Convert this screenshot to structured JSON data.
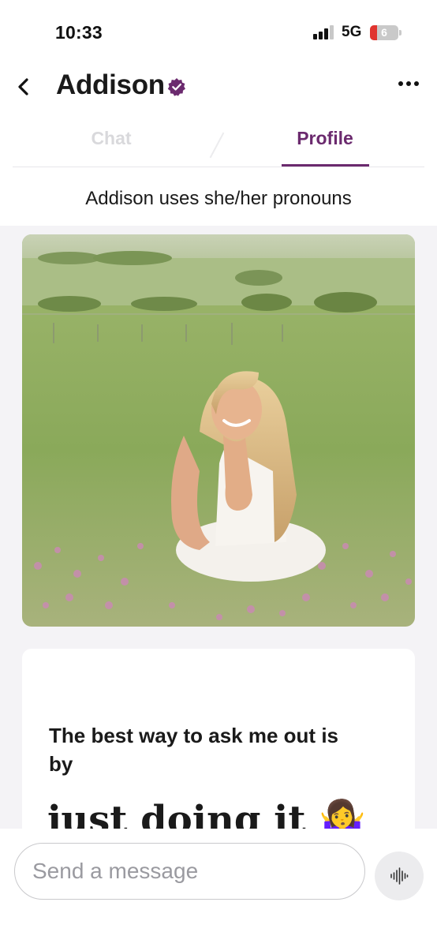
{
  "status_bar": {
    "time": "10:33",
    "network": "5G",
    "battery_level": "6"
  },
  "header": {
    "back_icon": "chevron-left-icon",
    "name": "Addison",
    "verified_icon": "verified-badge-icon",
    "more_icon": "more-horizontal-icon",
    "tabs": [
      {
        "label": "Chat",
        "active": false
      },
      {
        "label": "Profile",
        "active": true
      }
    ]
  },
  "profile": {
    "pronouns": "Addison uses she/her pronouns",
    "photo_icon": "profile-photo",
    "prompt": {
      "question": "The best way to ask me out is by",
      "answer": "just doing it 🤷‍♀️"
    }
  },
  "composer": {
    "placeholder": "Send a message",
    "voice_icon": "voice-waveform-icon"
  },
  "colors": {
    "accent": "#6b2a6e",
    "inactive_tab": "#d9d9dc",
    "background": "#f4f3f6"
  }
}
